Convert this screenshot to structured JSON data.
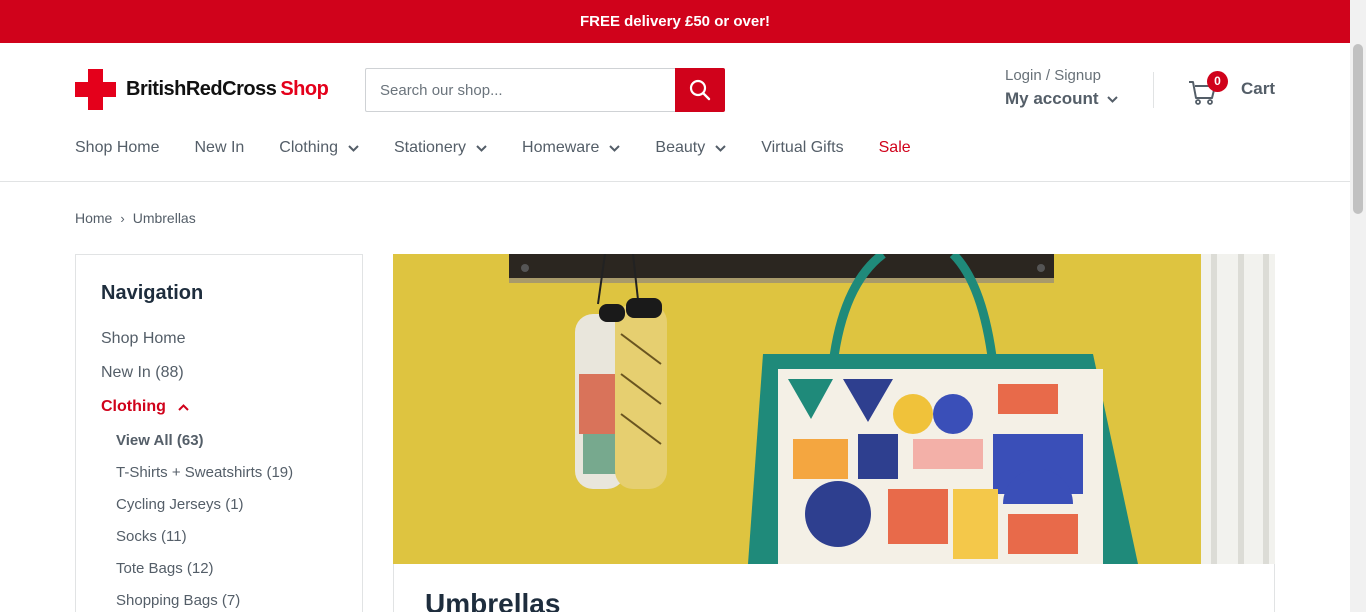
{
  "announcement": "FREE delivery £50 or over!",
  "brand": {
    "name": "BritishRedCross",
    "suffix": "Shop",
    "accent": "#d0021b"
  },
  "search": {
    "placeholder": "Search our shop..."
  },
  "account": {
    "login": "Login / Signup",
    "my_account": "My account"
  },
  "cart": {
    "label": "Cart",
    "count": "0"
  },
  "nav": [
    {
      "label": "Shop Home"
    },
    {
      "label": "New In"
    },
    {
      "label": "Clothing"
    },
    {
      "label": "Stationery"
    },
    {
      "label": "Homeware"
    },
    {
      "label": "Beauty"
    },
    {
      "label": "Virtual Gifts"
    },
    {
      "label": "Sale"
    }
  ],
  "breadcrumb": {
    "home": "Home",
    "separator": "›",
    "current": "Umbrellas"
  },
  "sidebar": {
    "title": "Navigation",
    "links": [
      "Shop Home",
      "New In (88)"
    ],
    "active": "Clothing",
    "subs": [
      "View All (63)",
      "T-Shirts + Sweatshirts (19)",
      "Cycling Jerseys (1)",
      "Socks (11)",
      "Tote Bags (12)",
      "Shopping Bags (7)"
    ]
  },
  "page": {
    "title": "Umbrellas"
  }
}
